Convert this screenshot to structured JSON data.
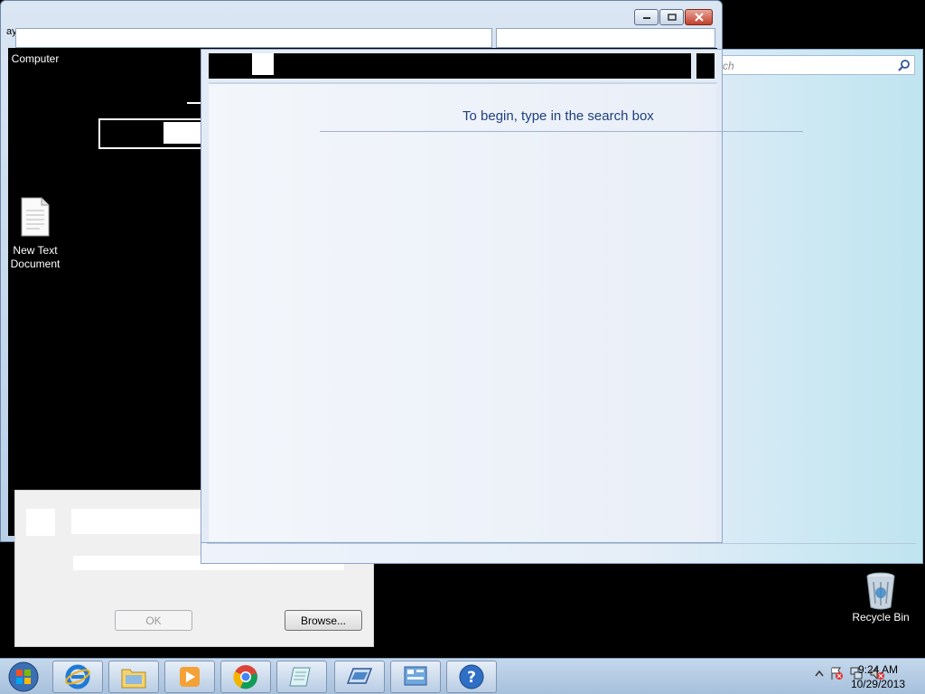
{
  "desktop": {
    "icons": [
      {
        "label": "Computer"
      },
      {
        "label": "New Text Document"
      },
      {
        "label": "Recycle Bin"
      }
    ]
  },
  "back_window": {
    "title_fragment": "ay"
  },
  "search_window": {
    "search_placeholder": "rch"
  },
  "help_window": {
    "prompt": "To begin, type in the search box"
  },
  "run_dialog": {
    "ok_label": "OK",
    "browse_label": "Browse..."
  },
  "taskbar": {
    "items": [
      {
        "name": "Internet Explorer"
      },
      {
        "name": "Windows Explorer"
      },
      {
        "name": "Windows Media Player"
      },
      {
        "name": "Google Chrome"
      },
      {
        "name": "Notepad"
      },
      {
        "name": "Remote Desktop"
      },
      {
        "name": "Control Panel"
      },
      {
        "name": "Help and Support"
      }
    ],
    "clock_time": "9:24 AM",
    "clock_date": "10/29/2013"
  }
}
